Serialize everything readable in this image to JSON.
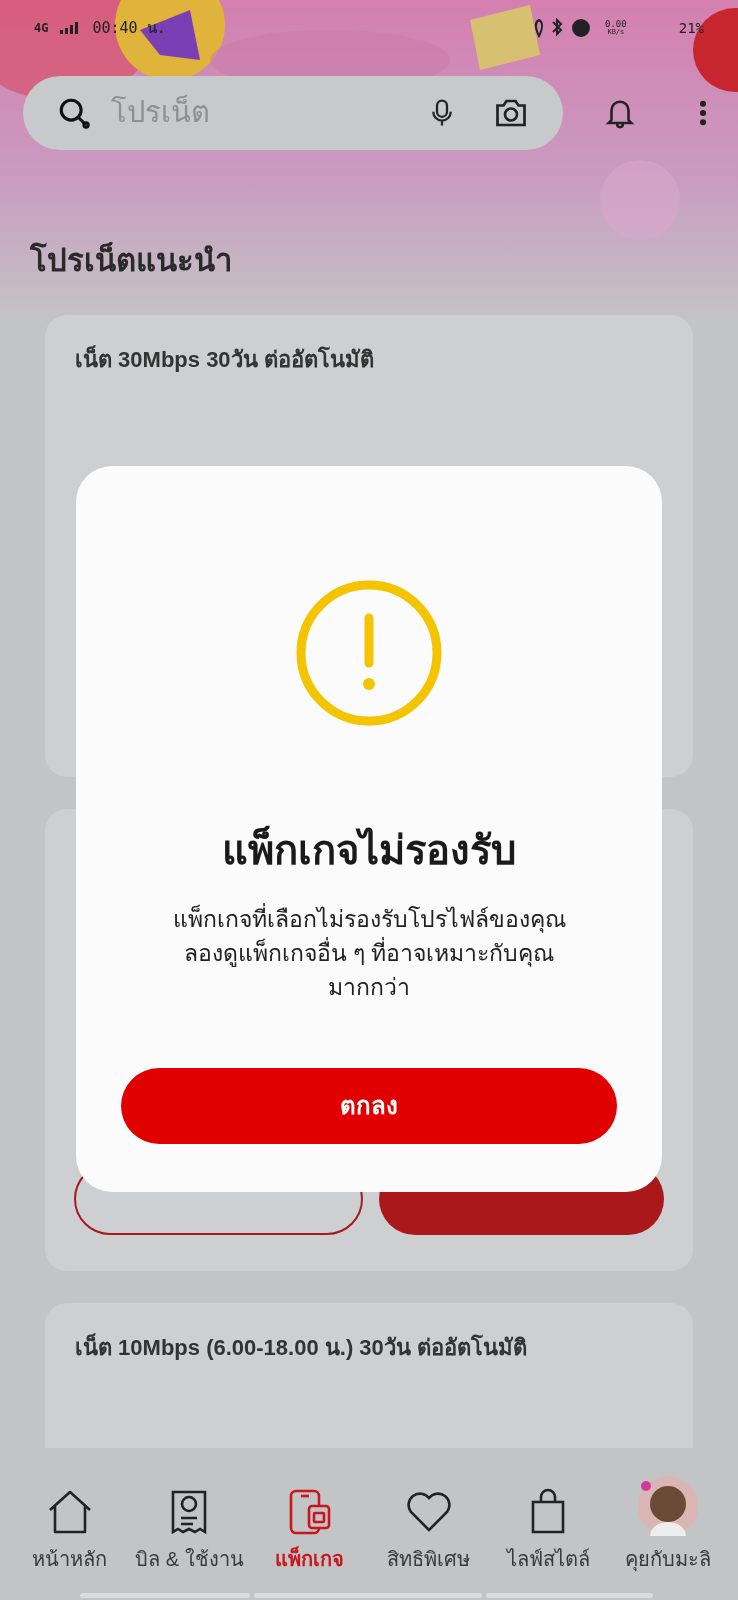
{
  "status_bar": {
    "network": "4G",
    "time": "00:40 น.",
    "speed": "0.00",
    "speed_unit": "KB/s",
    "battery": "21%"
  },
  "search": {
    "placeholder": "โปรเน็ต"
  },
  "section_title": "โปรเน็ตแนะนำ",
  "cards": [
    {
      "kind": "plain",
      "title": "เน็ต 30Mbps 30วัน ต่ออัตโนมัติ"
    },
    {
      "kind": "actions"
    },
    {
      "kind": "plain",
      "title": "เน็ต 10Mbps (6.00-18.00 น.) 30วัน ต่ออัตโนมัติ"
    }
  ],
  "dialog": {
    "title": "แพ็กเกจไม่รองรับ",
    "message": "แพ็กเกจที่เลือกไม่รองรับโปรไฟล์ของคุณ\nลองดูแพ็กเกจอื่น ๆ ที่อาจเหมาะกับคุณ\nมากกว่า",
    "button": "ตกลง"
  },
  "nav": [
    {
      "kind": "home",
      "label": "หน้าหลัก",
      "selected": false
    },
    {
      "kind": "bill",
      "label": "บิล & ใช้งาน",
      "selected": false
    },
    {
      "kind": "package",
      "label": "แพ็กเกจ",
      "selected": true
    },
    {
      "kind": "heart",
      "label": "สิทธิพิเศษ",
      "selected": false
    },
    {
      "kind": "bag",
      "label": "ไลฟ์สไตล์",
      "selected": false
    },
    {
      "kind": "avatar",
      "label": "คุยกับมะลิ",
      "selected": false
    }
  ]
}
